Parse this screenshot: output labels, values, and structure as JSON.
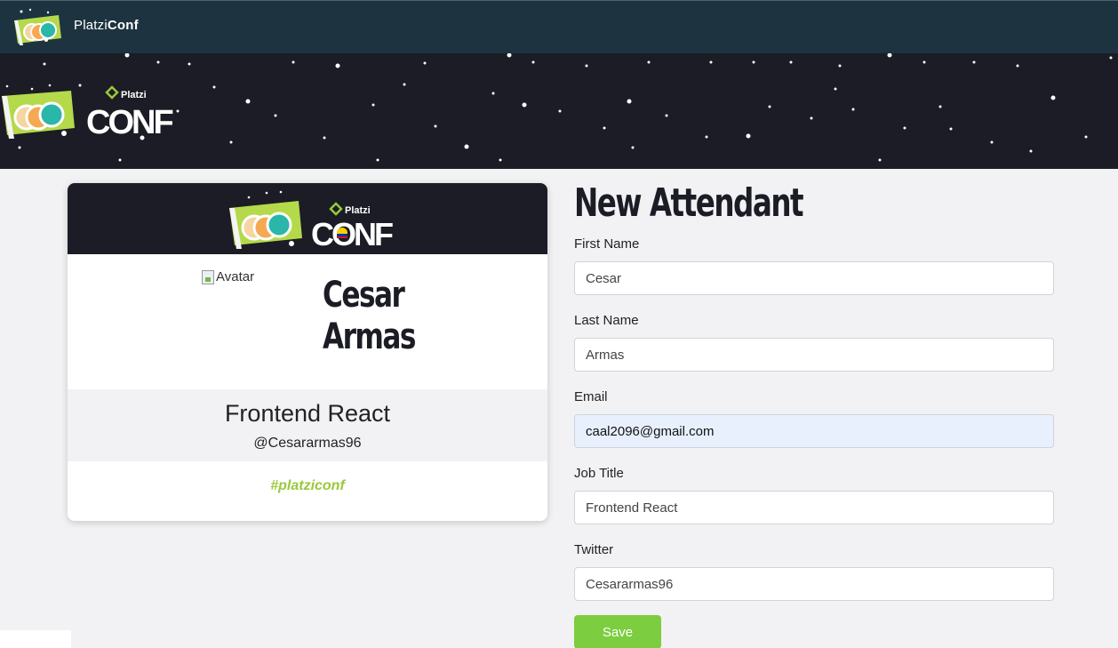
{
  "navbar": {
    "brand_light": "Platzi",
    "brand_bold": "Conf",
    "logo_icon": "platziconf-astronauts-logo"
  },
  "hero": {
    "logo_small_text": "Platzi",
    "logo_big_text": "CONF"
  },
  "badge": {
    "header_logo_small": "Platzi",
    "header_logo_big": "CONF",
    "avatar_alt": "Avatar",
    "first_name": "Cesar",
    "last_name": "Armas",
    "job_title": "Frontend React",
    "twitter": "@Cesararmas96",
    "hashtag": "#platziconf"
  },
  "form": {
    "title": "New Attendant",
    "fields": {
      "first_name": {
        "label": "First Name",
        "value": "Cesar"
      },
      "last_name": {
        "label": "Last Name",
        "value": "Armas"
      },
      "email": {
        "label": "Email",
        "value": "caal2096@gmail.com"
      },
      "job_title": {
        "label": "Job Title",
        "value": "Frontend React"
      },
      "twitter": {
        "label": "Twitter",
        "value": "Cesararmas96"
      }
    },
    "save_label": "Save"
  },
  "colors": {
    "navbar_bg": "#1d3340",
    "hero_bg": "#1b1c25",
    "accent_green": "#7dcd40",
    "hashtag_green": "#98c93c",
    "page_bg": "#f2f2f4"
  }
}
